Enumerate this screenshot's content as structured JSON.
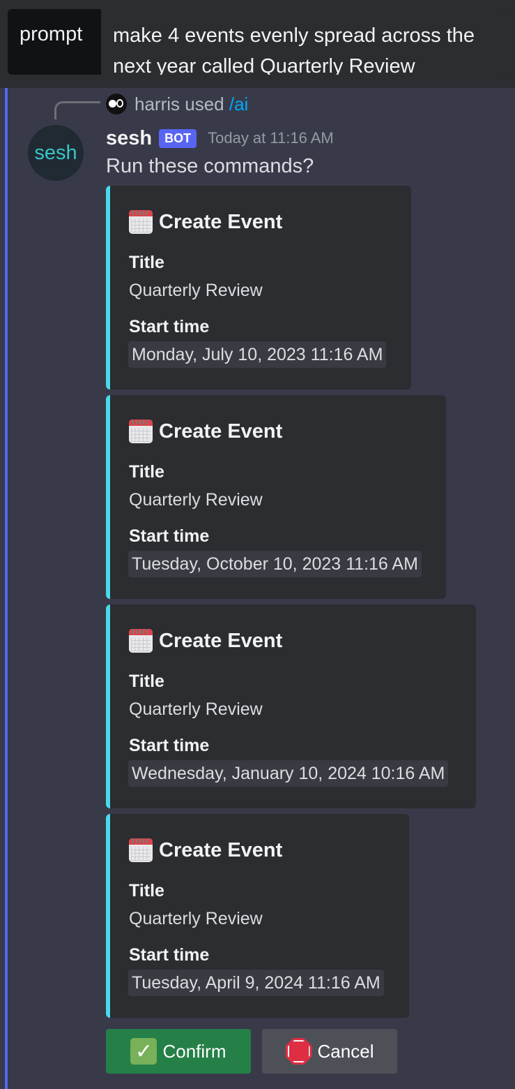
{
  "prompt_option": {
    "name": "prompt",
    "value_line1": "make 4 events evenly spread across the",
    "value_line2": "next year called Quarterly Review"
  },
  "reply": {
    "user": "harris",
    "used_text": "used",
    "command": "/ai"
  },
  "message": {
    "avatar_text": "sesh",
    "author": "sesh",
    "bot_tag": "BOT",
    "timestamp": "Today at 11:16 AM",
    "text": "Run these commands?"
  },
  "embeds": [
    {
      "icon": "calendar-icon",
      "title": "Create Event",
      "field1_name": "Title",
      "field1_value": "Quarterly Review",
      "field2_name": "Start time",
      "field2_value": "Monday, July 10, 2023 11:16 AM"
    },
    {
      "icon": "calendar-icon",
      "title": "Create Event",
      "field1_name": "Title",
      "field1_value": "Quarterly Review",
      "field2_name": "Start time",
      "field2_value": "Tuesday, October 10, 2023 11:16 AM"
    },
    {
      "icon": "calendar-icon",
      "title": "Create Event",
      "field1_name": "Title",
      "field1_value": "Quarterly Review",
      "field2_name": "Start time",
      "field2_value": "Wednesday, January 10, 2024 10:16 AM"
    },
    {
      "icon": "calendar-icon",
      "title": "Create Event",
      "field1_name": "Title",
      "field1_value": "Quarterly Review",
      "field2_name": "Start time",
      "field2_value": "Tuesday, April 9, 2024 11:16 AM"
    }
  ],
  "buttons": {
    "confirm_label": "Confirm",
    "confirm_icon": "check-mark-icon",
    "cancel_label": "Cancel",
    "cancel_icon": "stop-sign-icon"
  },
  "colors": {
    "accent": "#5865f2",
    "embed_border": "#4ad9ea",
    "confirm": "#248046",
    "cancel": "#4e5058"
  }
}
